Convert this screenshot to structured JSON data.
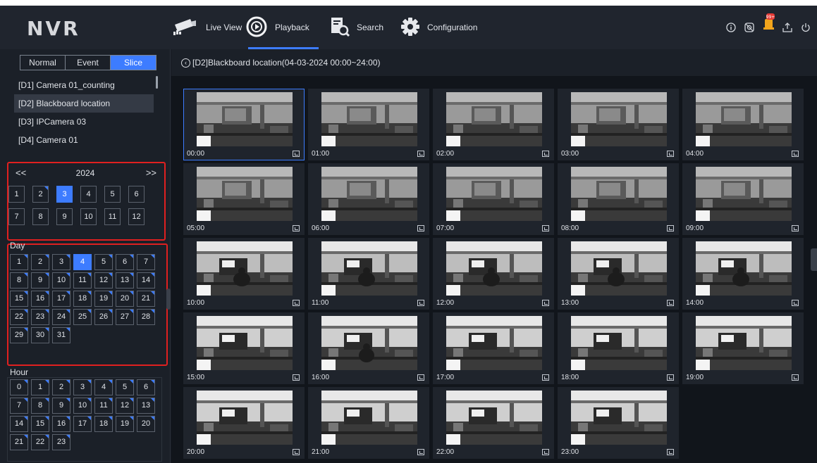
{
  "app": {
    "brand": "NVR"
  },
  "nav": [
    {
      "label": "Live View",
      "icon": "camera-icon"
    },
    {
      "label": "Playback",
      "icon": "playback-icon"
    },
    {
      "label": "Search",
      "icon": "search-icon"
    },
    {
      "label": "Configuration",
      "icon": "gear-icon"
    }
  ],
  "active_nav": "Playback",
  "top_icons": [
    "info-icon",
    "recording-status-icon",
    "alarm-notification-icon",
    "export-icon",
    "power-icon"
  ],
  "alarm_badge": "99+",
  "colors": {
    "accent": "#3d7cff",
    "highlight_box": "#e02020",
    "background": "#161a22"
  },
  "sidebar": {
    "modes": [
      "Normal",
      "Event",
      "Slice"
    ],
    "selected_mode": "Slice",
    "cameras": [
      "[D1] Camera 01_counting",
      "[D2] Blackboard location",
      "[D3] IPCamera 03",
      "[D4] Camera 01"
    ],
    "selected_camera": "[D2] Blackboard location",
    "year": {
      "prev": "<<",
      "label": "2024",
      "next": ">>"
    },
    "months": [
      "1",
      "2",
      "3",
      "4",
      "5",
      "6",
      "7",
      "8",
      "9",
      "10",
      "11",
      "12"
    ],
    "selected_month": "3",
    "months_with_records": [
      "2",
      "3"
    ],
    "day_label": "Day",
    "days": [
      "1",
      "2",
      "3",
      "4",
      "5",
      "6",
      "7",
      "8",
      "9",
      "10",
      "11",
      "12",
      "13",
      "14",
      "15",
      "16",
      "17",
      "18",
      "19",
      "20",
      "21",
      "22",
      "23",
      "24",
      "25",
      "26",
      "27",
      "28",
      "29",
      "30",
      "31"
    ],
    "selected_day": "4",
    "days_with_records": [
      "1",
      "2",
      "3",
      "4",
      "5",
      "6",
      "7",
      "8",
      "9",
      "10",
      "11",
      "12",
      "13",
      "14",
      "15",
      "16",
      "17",
      "18",
      "19",
      "20",
      "21",
      "22",
      "23",
      "24",
      "25",
      "26",
      "27",
      "28",
      "29",
      "30",
      "31"
    ],
    "hour_label": "Hour",
    "hours": [
      "0",
      "1",
      "2",
      "3",
      "4",
      "5",
      "6",
      "7",
      "8",
      "9",
      "10",
      "11",
      "12",
      "13",
      "14",
      "15",
      "16",
      "17",
      "18",
      "19",
      "20",
      "21",
      "22",
      "23"
    ],
    "hours_with_records": [
      "0",
      "1",
      "2",
      "3",
      "4",
      "5",
      "6",
      "7",
      "8",
      "9",
      "10",
      "11",
      "12",
      "13",
      "14",
      "15",
      "16",
      "17",
      "18",
      "19",
      "20",
      "21",
      "22",
      "23"
    ]
  },
  "main": {
    "title": "[D2]Blackboard location(04-03-2024 00:00~24:00)",
    "selected_slice": "00:00",
    "slices": [
      "00:00",
      "01:00",
      "02:00",
      "03:00",
      "04:00",
      "05:00",
      "06:00",
      "07:00",
      "08:00",
      "09:00",
      "10:00",
      "11:00",
      "12:00",
      "13:00",
      "14:00",
      "15:00",
      "16:00",
      "17:00",
      "18:00",
      "19:00",
      "20:00",
      "21:00",
      "22:00",
      "23:00"
    ]
  }
}
